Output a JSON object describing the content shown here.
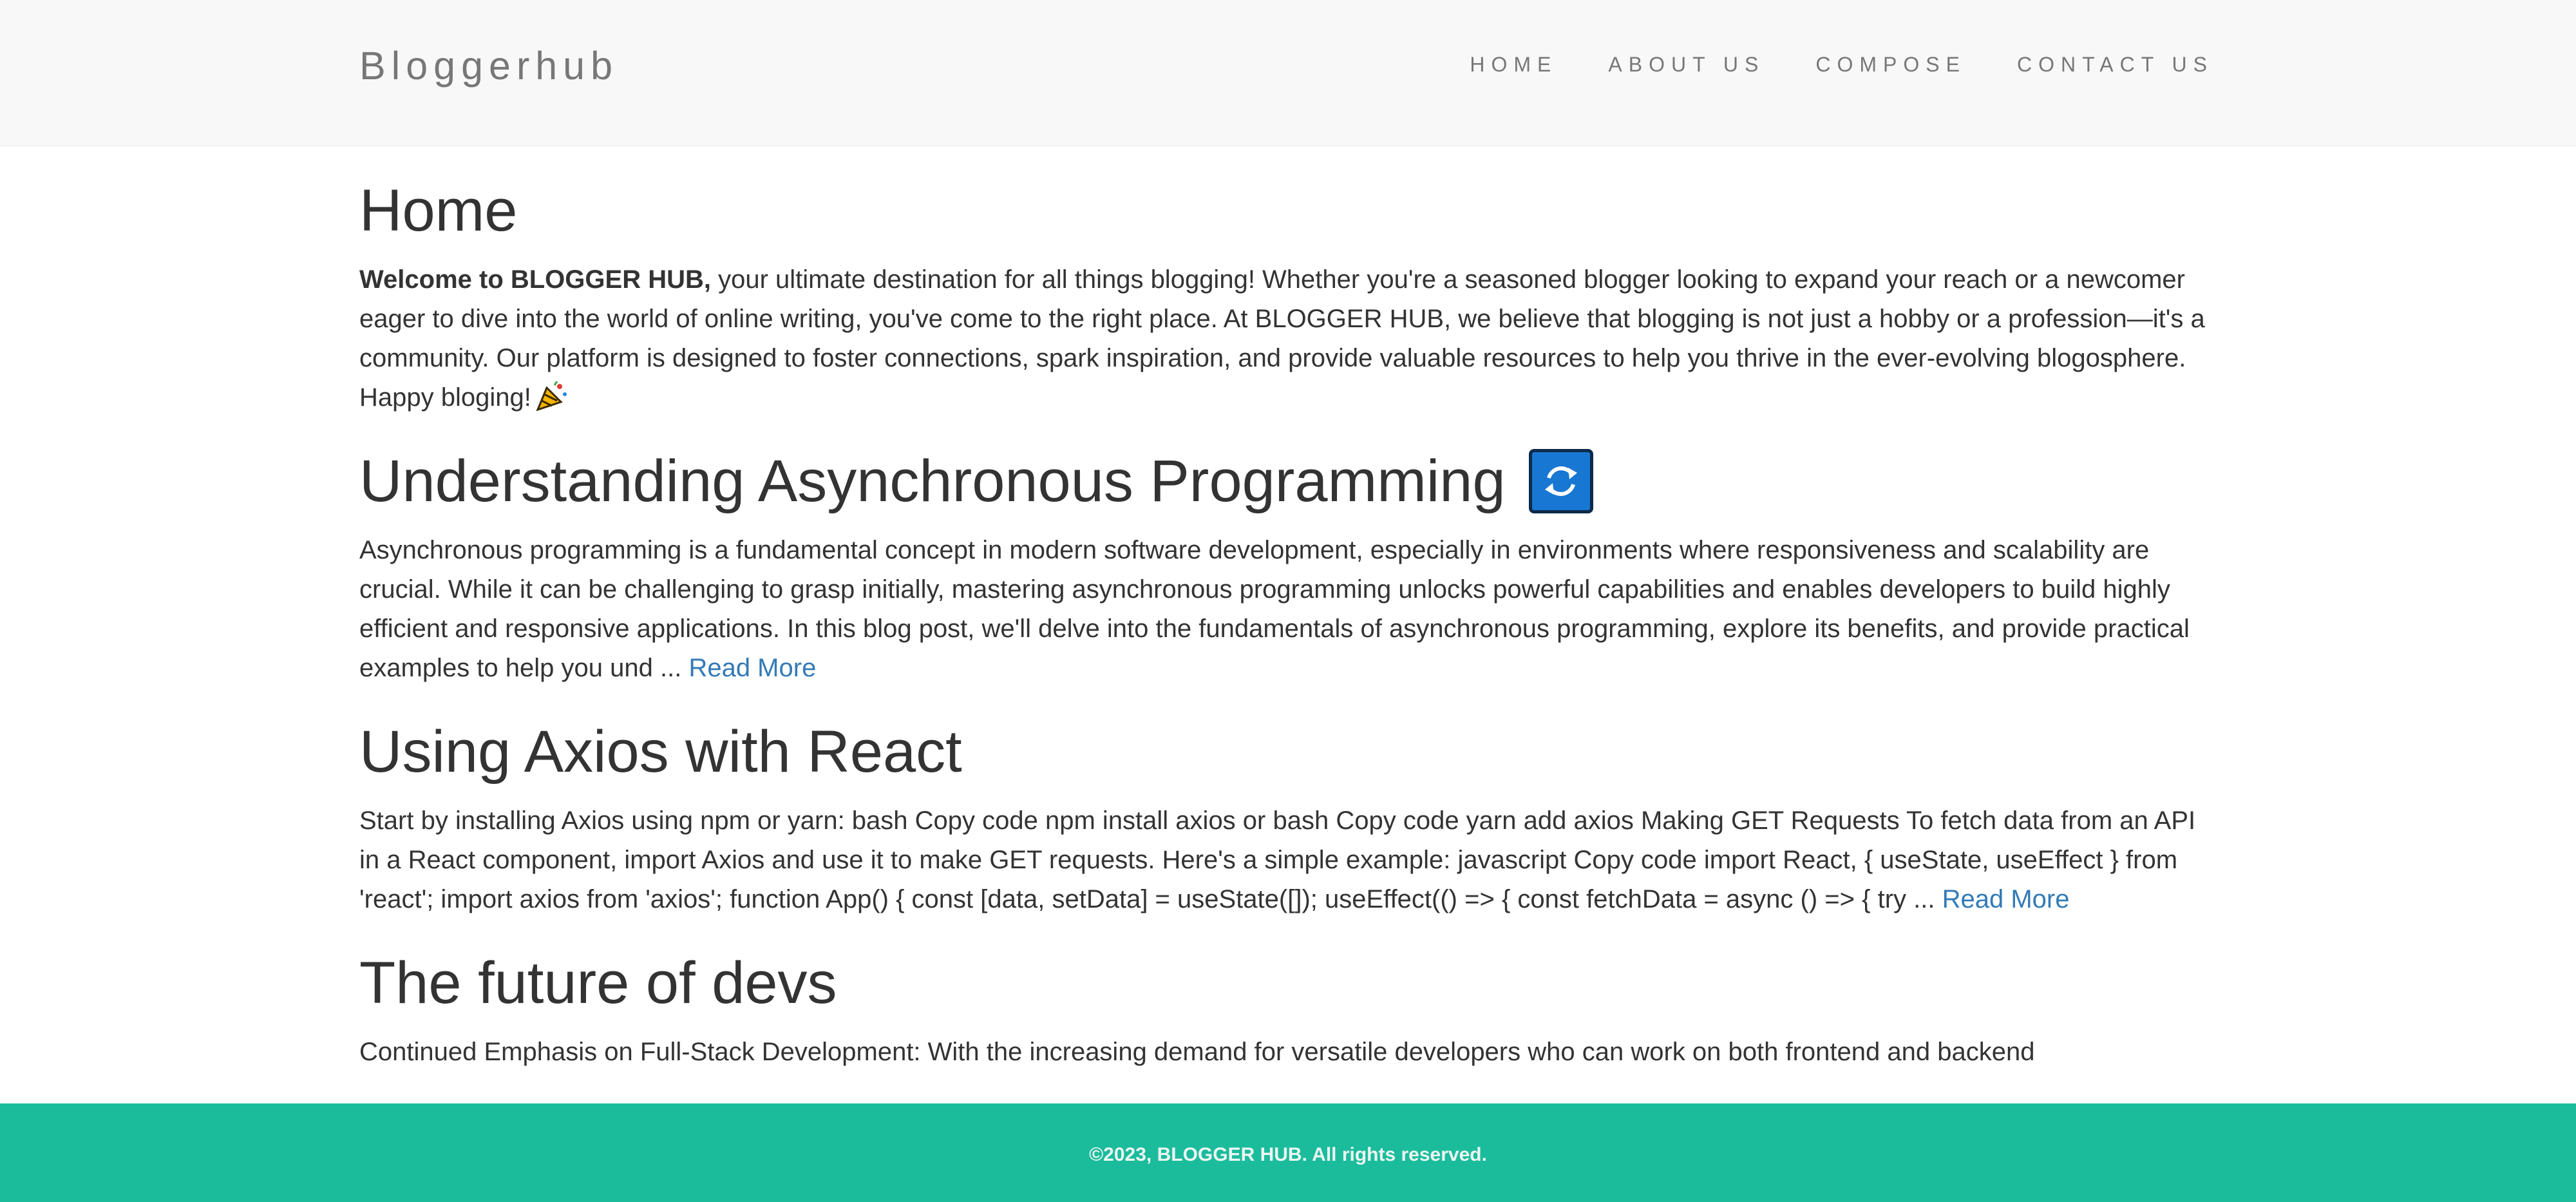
{
  "navbar": {
    "brand": "Bloggerhub",
    "links": [
      "HOME",
      "ABOUT US",
      "COMPOSE",
      "CONTACT US"
    ]
  },
  "home": {
    "title": "Home",
    "intro_bold": "Welcome to BLOGGER HUB,",
    "intro_text": " your ultimate destination for all things blogging! Whether you're a seasoned blogger looking to expand your reach or a newcomer eager to dive into the world of online writing, you've come to the right place. At BLOGGER HUB, we believe that blogging is not just a hobby or a profession—it's a community. Our platform is designed to foster connections, spark inspiration, and provide valuable resources to help you thrive in the ever-evolving blogosphere. Happy bloging!",
    "intro_emoji": "party-popper-icon"
  },
  "posts": [
    {
      "title": "Understanding Asynchronous Programming",
      "title_icon": "sync-icon",
      "excerpt": "Asynchronous programming is a fundamental concept in modern software development, especially in environments where responsiveness and scalability are crucial. While it can be challenging to grasp initially, mastering asynchronous programming unlocks powerful capabilities and enables developers to build highly efficient and responsive applications. In this blog post, we'll delve into the fundamentals of asynchronous programming, explore its benefits, and provide practical examples to help you und ...",
      "read_more": "Read More"
    },
    {
      "title": "Using Axios with React",
      "excerpt": "Start by installing Axios using npm or yarn: bash Copy code npm install axios or bash Copy code yarn add axios Making GET Requests To fetch data from an API in a React component, import Axios and use it to make GET requests. Here's a simple example: javascript Copy code import React, { useState, useEffect } from 'react'; import axios from 'axios'; function App() { const [data, setData] = useState([]); useEffect(() => { const fetchData = async () => { try ...",
      "read_more": "Read More"
    },
    {
      "title": "The future of devs",
      "excerpt": "Continued Emphasis on Full-Stack Development: With the increasing demand for versatile developers who can work on both frontend and backend"
    }
  ],
  "footer": {
    "text": "©2023, BLOGGER HUB. All rights reserved."
  },
  "colors": {
    "navbar_bg": "#f8f8f8",
    "footer_bg": "#1abc9c",
    "link": "#337ab7",
    "text": "#333333"
  }
}
